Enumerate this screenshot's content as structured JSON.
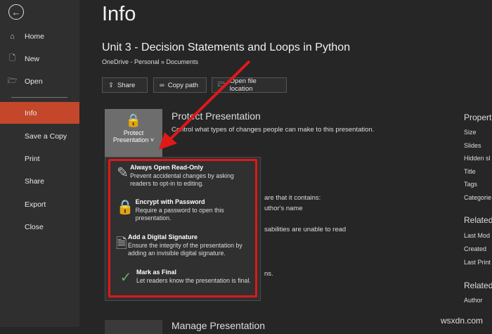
{
  "sidebar": {
    "items": [
      {
        "label": "Home"
      },
      {
        "label": "New"
      },
      {
        "label": "Open"
      },
      {
        "label": "Info"
      },
      {
        "label": "Save a Copy"
      },
      {
        "label": "Print"
      },
      {
        "label": "Share"
      },
      {
        "label": "Export"
      },
      {
        "label": "Close"
      }
    ]
  },
  "header": {
    "title": "Info",
    "doc_title": "Unit 3 - Decision Statements and Loops in Python",
    "path": "OneDrive - Personal » Documents"
  },
  "actions": {
    "share": "Share",
    "copy_path": "Copy path",
    "open_location": "Open file location"
  },
  "protect": {
    "button_line1": "Protect",
    "button_line2": "Presentation",
    "title": "Protect Presentation",
    "desc": "Control what types of changes people can make to this presentation."
  },
  "inspect_partial": [
    "are that it contains:",
    "uthor's name",
    "sabilities are unable to read",
    "ns."
  ],
  "menu": [
    {
      "title": "Always Open Read-Only",
      "desc": "Prevent accidental changes by asking readers to opt-in to editing."
    },
    {
      "title": "Encrypt with Password",
      "desc": "Require a password to open this presentation."
    },
    {
      "title": "Add a Digital Signature",
      "desc": "Ensure the integrity of the presentation by adding an invisible digital signature."
    },
    {
      "title": "Mark as Final",
      "desc": "Let readers know the presentation is final."
    }
  ],
  "manage": {
    "title": "Manage Presentation"
  },
  "properties": {
    "heading": "Propert",
    "items": [
      "Size",
      "Slides",
      "Hidden sl",
      "Title",
      "Tags",
      "Categorie"
    ],
    "related_dates_heading": "Related",
    "dates": [
      "Last Mod",
      "Created",
      "Last Print"
    ],
    "related_people_heading": "Related",
    "people": [
      "Author"
    ]
  },
  "watermark": "wsxdn.com"
}
